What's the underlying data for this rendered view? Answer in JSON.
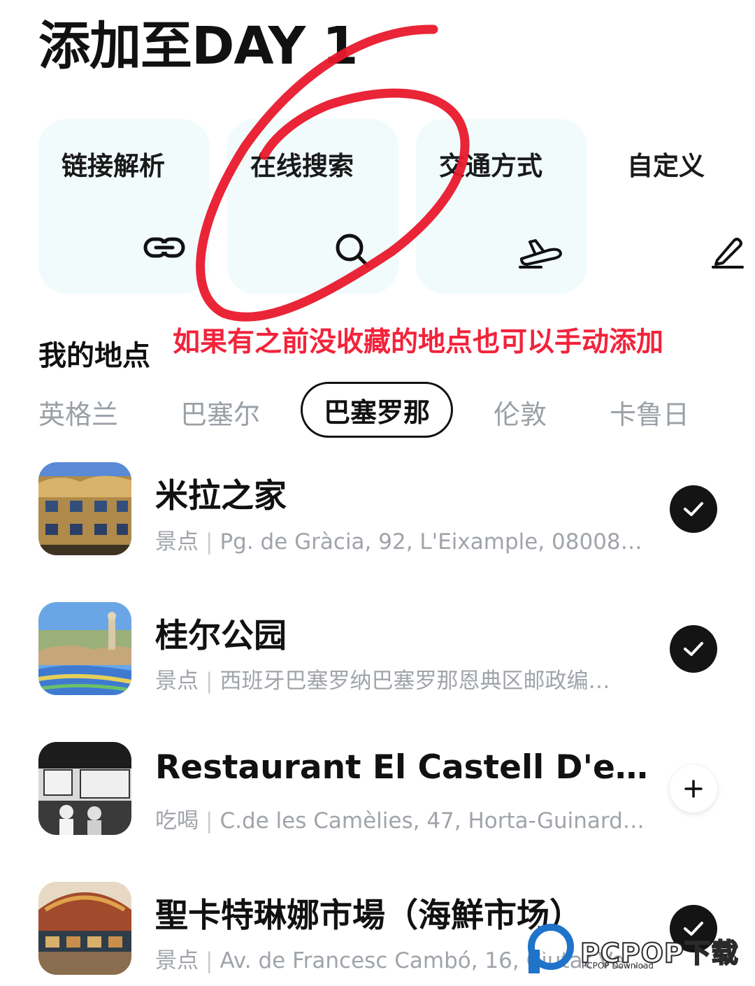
{
  "header": {
    "title": "添加至DAY 1"
  },
  "tools": [
    {
      "label": "链接解析",
      "icon": "link-icon"
    },
    {
      "label": "在线搜索",
      "icon": "search-icon"
    },
    {
      "label": "交通方式",
      "icon": "plane-icon"
    },
    {
      "label": "自定义",
      "icon": "pencil-icon"
    }
  ],
  "annotation": {
    "text": "如果有之前没收藏的地点也可以手动添加",
    "color": "#f2233b"
  },
  "section": {
    "title": "我的地点"
  },
  "city_tabs": [
    {
      "label": "英格兰",
      "active": false
    },
    {
      "label": "巴塞尔",
      "active": false
    },
    {
      "label": "巴塞罗那",
      "active": true
    },
    {
      "label": "伦敦",
      "active": false
    },
    {
      "label": "卡鲁日",
      "active": false
    }
  ],
  "places": [
    {
      "name": "米拉之家",
      "category": "景点",
      "address": "Pg. de Gràcia, 92, L'Eixample, 08008…",
      "added": true
    },
    {
      "name": "桂尔公园",
      "category": "景点",
      "address": "西班牙巴塞罗纳巴塞罗那恩典区邮政编…",
      "added": true
    },
    {
      "name": "Restaurant El Castell D'en S…",
      "category": "吃喝",
      "address": "C.de les Camèlies, 47, Horta-Guinard…",
      "added": false
    },
    {
      "name": "聖卡特琳娜市場（海鮮市场）",
      "category": "景点",
      "address": "Av. de Francesc Cambó, 16, Ciutat Ve…",
      "added": true
    }
  ],
  "watermark": {
    "brand": "PCPOP下载",
    "sub": "PCPOP Download"
  }
}
